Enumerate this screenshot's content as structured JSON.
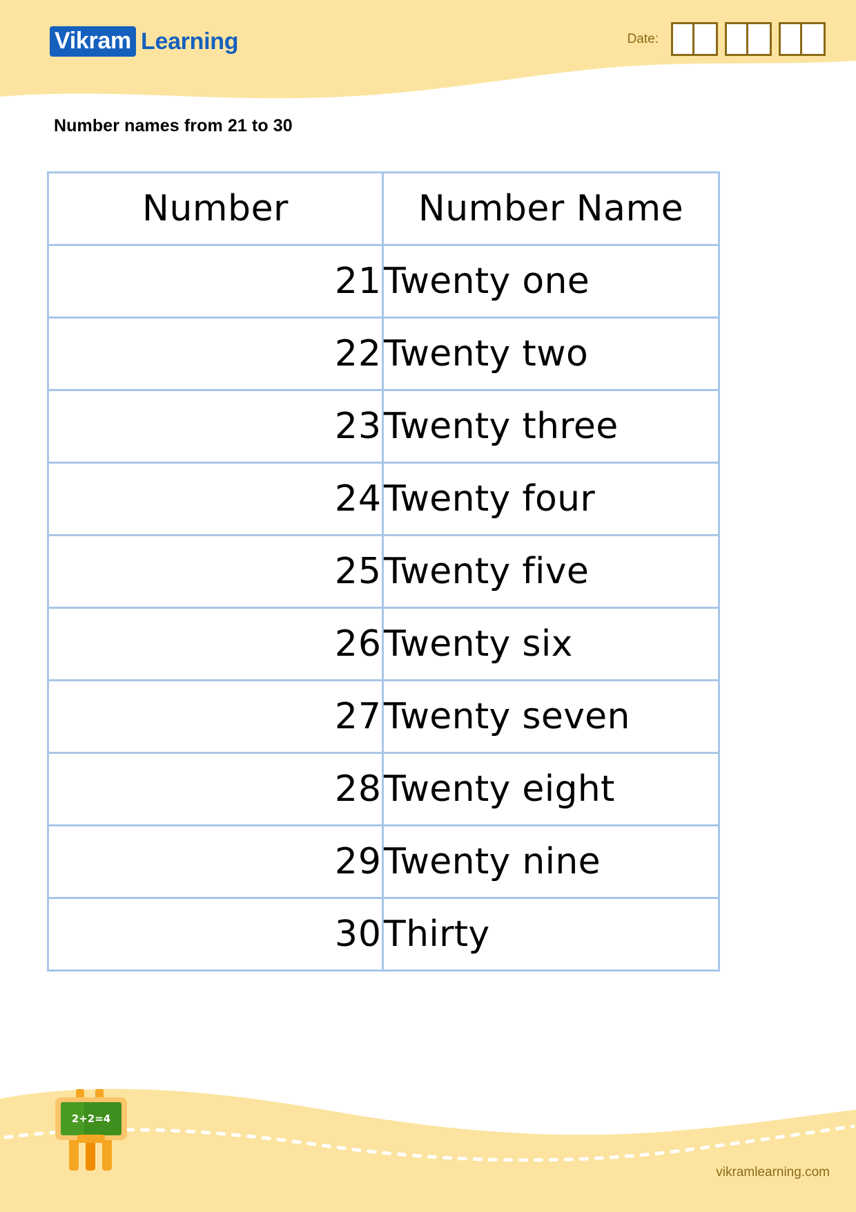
{
  "page": {
    "background_color": "#ffffff",
    "band_color": "#fce4a0",
    "accent_blue": "#1560bd",
    "table_border_color": "#a8c6e8",
    "brown_text_color": "#8a6a16"
  },
  "header": {
    "logo": {
      "badge_text": "Vikram",
      "word_text": "Learning"
    },
    "date": {
      "label": "Date:",
      "group_count": 3,
      "boxes_per_group": 2,
      "values": [
        "",
        "",
        "",
        "",
        "",
        ""
      ]
    }
  },
  "title": "Number names from 21 to 30",
  "table": {
    "columns": [
      "Number",
      "Number Name"
    ],
    "rows": [
      {
        "number": "21",
        "name": "Twenty one"
      },
      {
        "number": "22",
        "name": "Twenty two"
      },
      {
        "number": "23",
        "name": "Twenty three"
      },
      {
        "number": "24",
        "name": "Twenty four"
      },
      {
        "number": "25",
        "name": "Twenty five"
      },
      {
        "number": "26",
        "name": "Twenty six"
      },
      {
        "number": "27",
        "name": "Twenty seven"
      },
      {
        "number": "28",
        "name": "Twenty eight"
      },
      {
        "number": "29",
        "name": "Twenty nine"
      },
      {
        "number": "30",
        "name": "Thirty"
      }
    ]
  },
  "footer": {
    "easel": {
      "icon": "blackboard-easel-icon",
      "board_text": "2+2=4",
      "board_color": "#4a9b23",
      "frame_color": "#f5a623"
    },
    "url": "vikramlearning.com"
  }
}
